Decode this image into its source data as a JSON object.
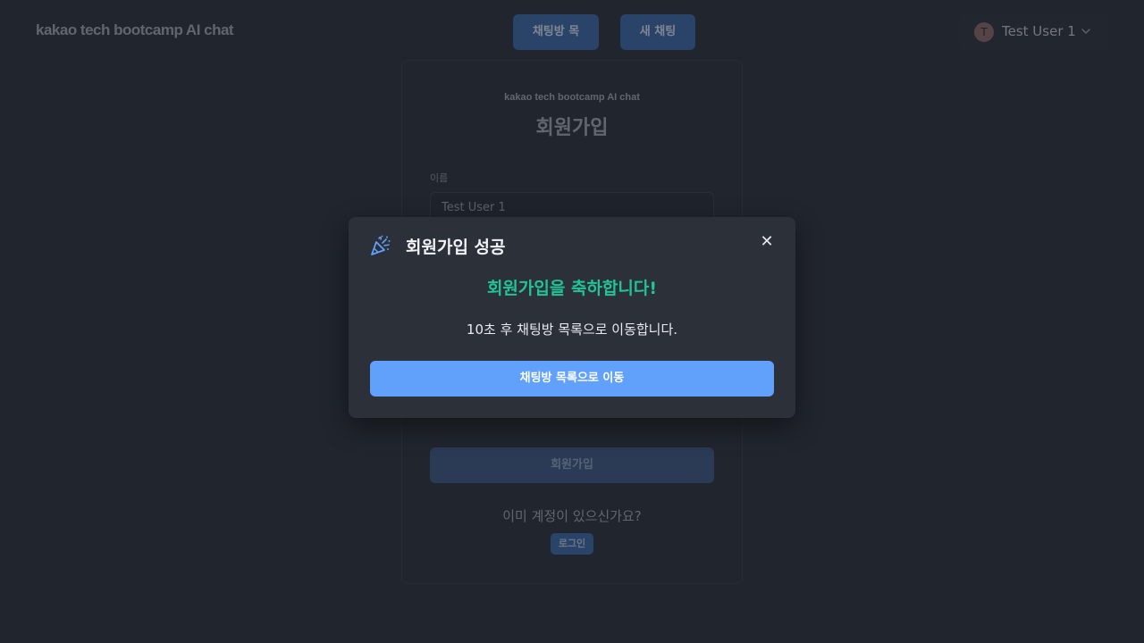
{
  "colors": {
    "background": "#2e333d",
    "primary": "#61a0fb",
    "success": "#21c494",
    "modal_bg": "#2c3039"
  },
  "header": {
    "brand": "kakao tech bootcamp AI chat",
    "nav": {
      "chat_list_label": "채팅방 목록",
      "new_chat_label": "새 채팅방"
    },
    "user": {
      "avatar_initial": "T",
      "name": "Test User 1",
      "menu_icon": "chevron-down-icon"
    }
  },
  "signup_card": {
    "brand": "kakao tech bootcamp AI chat",
    "title": "회원가입",
    "name_label": "이름",
    "name_value": "Test User 1",
    "submit_label": "회원가입",
    "have_account_text": "이미 계정이 있으신가요?",
    "login_label": "로그인"
  },
  "modal": {
    "icon": "party-popper-icon",
    "title": "회원가입 성공",
    "close_icon": "close-icon",
    "close_symbol": "✕",
    "congrats": "회원가입을 축하합니다!",
    "redirect_message": "10초 후 채팅방 목록으로 이동합니다.",
    "button_label": "채팅방 목록으로 이동"
  }
}
